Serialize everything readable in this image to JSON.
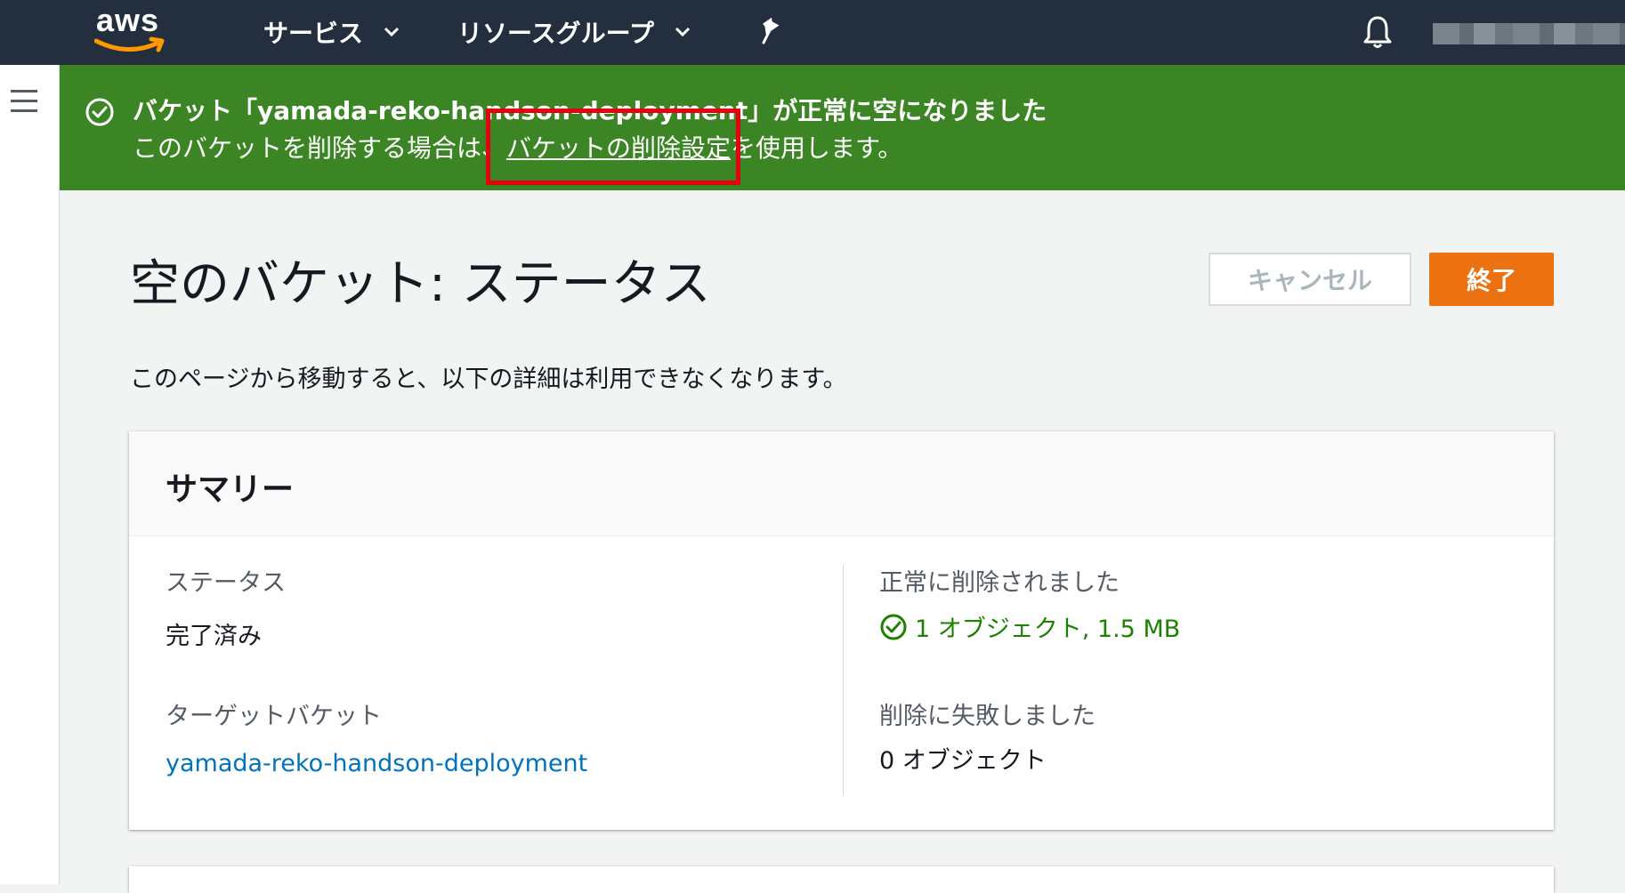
{
  "nav": {
    "logo": "aws",
    "services": "サービス",
    "resource_groups": "リソースグループ",
    "icons": [
      "aws-logo",
      "chevron-down-icon",
      "pin-icon",
      "bell-icon",
      "hamburger-menu-icon"
    ]
  },
  "flash": {
    "title": "バケット「yamada-reko-handson-deployment」が正常に空になりました",
    "body_prefix": "このバケットを削除する場合は、",
    "link": "バケットの削除設定",
    "body_suffix": "を使用します。",
    "icon": "check-circle-icon",
    "color": "#3b8524"
  },
  "header": {
    "title": "空のバケット: ステータス",
    "cancel_label": "キャンセル",
    "finish_label": "終了",
    "accent": "#ec7211"
  },
  "description": "このページから移動すると、以下の詳細は利用できなくなります。",
  "summary": {
    "title": "サマリー",
    "status_label": "ステータス",
    "status_value": "完了済み",
    "target_label": "ターゲットバケット",
    "target_value": "yamada-reko-handson-deployment",
    "success_label": "正常に削除されました",
    "success_value": "1 オブジェクト, 1.5 MB",
    "failed_label": "削除に失敗しました",
    "failed_value": "0 オブジェクト",
    "success_color": "#1d8102",
    "link_color": "#0073bb"
  }
}
